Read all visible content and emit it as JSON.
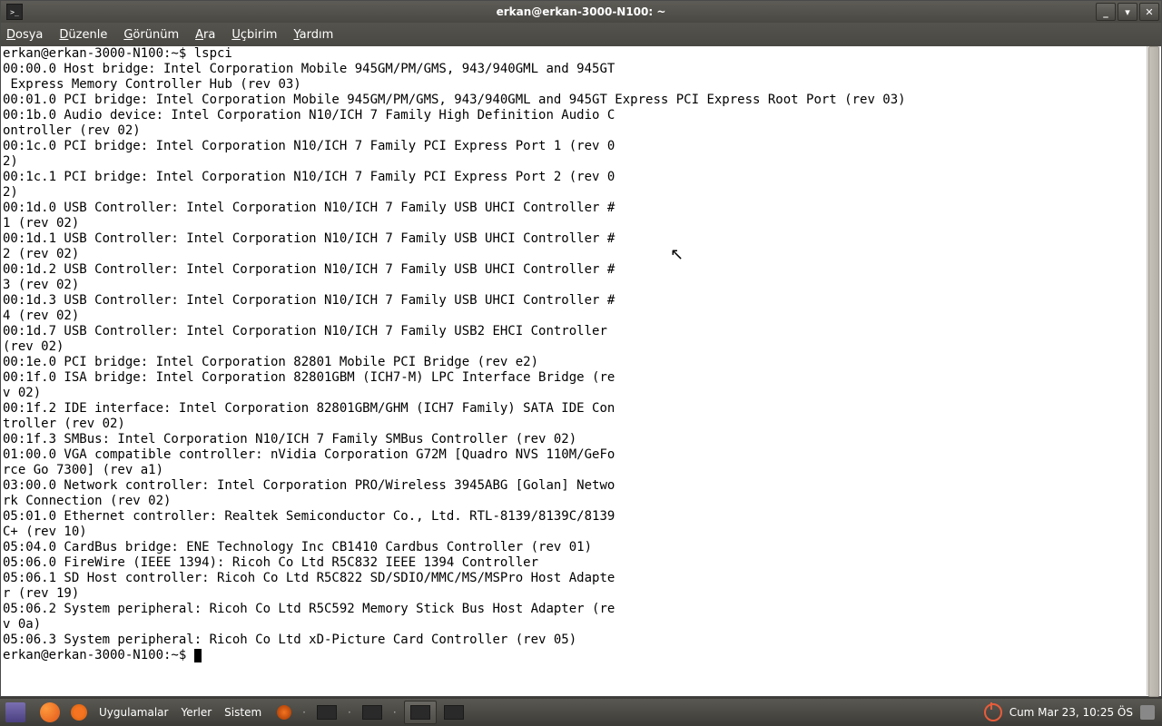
{
  "window": {
    "title": "erkan@erkan-3000-N100: ~"
  },
  "menubar": {
    "file": "Dosya",
    "edit": "Düzenle",
    "view": "Görünüm",
    "search": "Ara",
    "terminal": "Uçbirim",
    "help": "Yardım"
  },
  "terminal": {
    "prompt1": "erkan@erkan-3000-N100:~$ ",
    "command1": "lspci",
    "output": "00:00.0 Host bridge: Intel Corporation Mobile 945GM/PM/GMS, 943/940GML and 945GT\n Express Memory Controller Hub (rev 03)\n00:01.0 PCI bridge: Intel Corporation Mobile 945GM/PM/GMS, 943/940GML and 945GT Express PCI Express Root Port (rev 03)\n00:1b.0 Audio device: Intel Corporation N10/ICH 7 Family High Definition Audio C\nontroller (rev 02)\n00:1c.0 PCI bridge: Intel Corporation N10/ICH 7 Family PCI Express Port 1 (rev 0\n2)\n00:1c.1 PCI bridge: Intel Corporation N10/ICH 7 Family PCI Express Port 2 (rev 0\n2)\n00:1d.0 USB Controller: Intel Corporation N10/ICH 7 Family USB UHCI Controller #\n1 (rev 02)\n00:1d.1 USB Controller: Intel Corporation N10/ICH 7 Family USB UHCI Controller #\n2 (rev 02)\n00:1d.2 USB Controller: Intel Corporation N10/ICH 7 Family USB UHCI Controller #\n3 (rev 02)\n00:1d.3 USB Controller: Intel Corporation N10/ICH 7 Family USB UHCI Controller #\n4 (rev 02)\n00:1d.7 USB Controller: Intel Corporation N10/ICH 7 Family USB2 EHCI Controller \n(rev 02)\n00:1e.0 PCI bridge: Intel Corporation 82801 Mobile PCI Bridge (rev e2)\n00:1f.0 ISA bridge: Intel Corporation 82801GBM (ICH7-M) LPC Interface Bridge (re\nv 02)\n00:1f.2 IDE interface: Intel Corporation 82801GBM/GHM (ICH7 Family) SATA IDE Con\ntroller (rev 02)\n00:1f.3 SMBus: Intel Corporation N10/ICH 7 Family SMBus Controller (rev 02)\n01:00.0 VGA compatible controller: nVidia Corporation G72M [Quadro NVS 110M/GeFo\nrce Go 7300] (rev a1)\n03:00.0 Network controller: Intel Corporation PRO/Wireless 3945ABG [Golan] Netwo\nrk Connection (rev 02)\n05:01.0 Ethernet controller: Realtek Semiconductor Co., Ltd. RTL-8139/8139C/8139\nC+ (rev 10)\n05:04.0 CardBus bridge: ENE Technology Inc CB1410 Cardbus Controller (rev 01)\n05:06.0 FireWire (IEEE 1394): Ricoh Co Ltd R5C832 IEEE 1394 Controller\n05:06.1 SD Host controller: Ricoh Co Ltd R5C822 SD/SDIO/MMC/MS/MSPro Host Adapte\nr (rev 19)\n05:06.2 System peripheral: Ricoh Co Ltd R5C592 Memory Stick Bus Host Adapter (re\nv 0a)\n05:06.3 System peripheral: Ricoh Co Ltd xD-Picture Card Controller (rev 05)",
    "prompt2": "erkan@erkan-3000-N100:~$ "
  },
  "taskbar": {
    "apps": "Uygulamalar",
    "places": "Yerler",
    "system": "Sistem",
    "clock": "Cum Mar 23, 10:25 ÖS"
  }
}
